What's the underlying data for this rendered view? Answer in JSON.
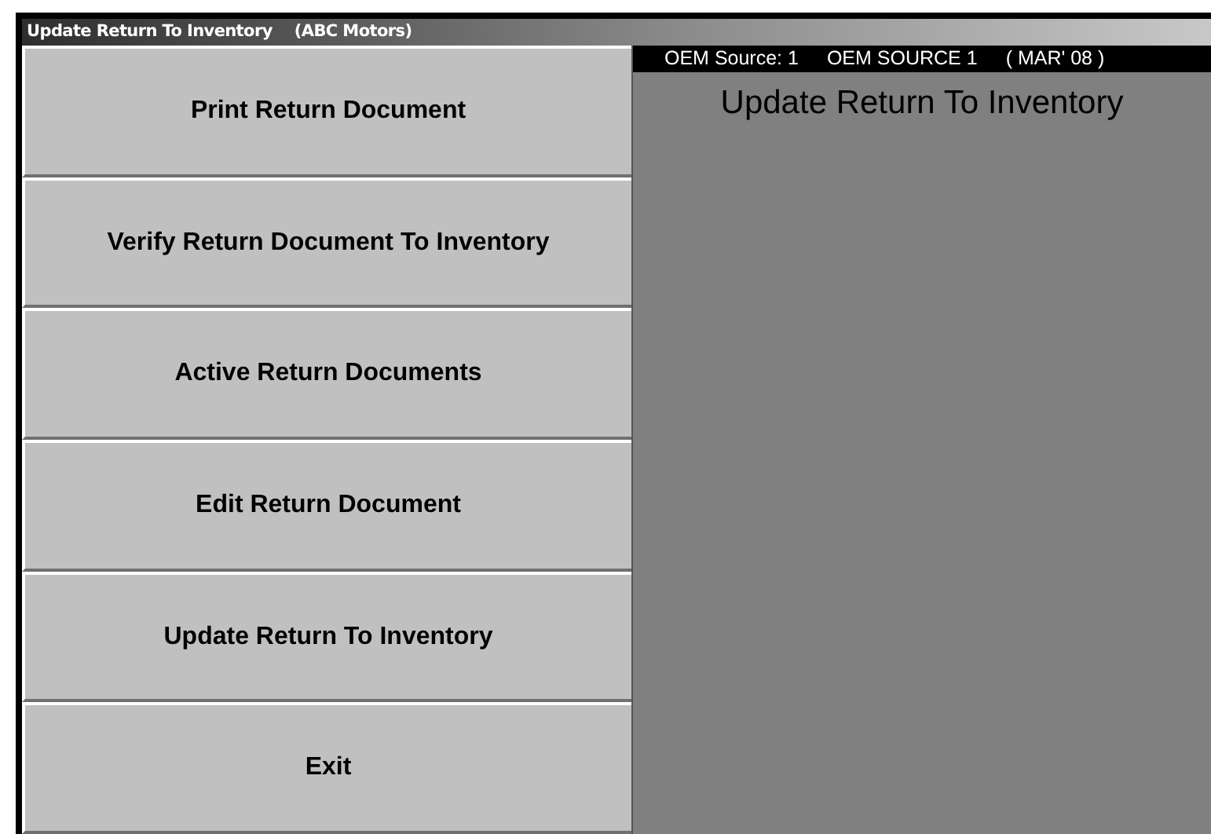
{
  "window": {
    "title": "Update Return To Inventory",
    "company": "(ABC Motors)"
  },
  "menu": [
    {
      "label": "Print Return Document"
    },
    {
      "label": "Verify Return Document To Inventory"
    },
    {
      "label": "Active Return Documents"
    },
    {
      "label": "Edit Return Document"
    },
    {
      "label": "Update Return To Inventory"
    },
    {
      "label": "Exit"
    }
  ],
  "info_bar": {
    "source": "OEM Source: 1",
    "source_name": "OEM SOURCE 1",
    "period": "( MAR' 08 )"
  },
  "panel": {
    "heading": "Update Return To Inventory"
  }
}
